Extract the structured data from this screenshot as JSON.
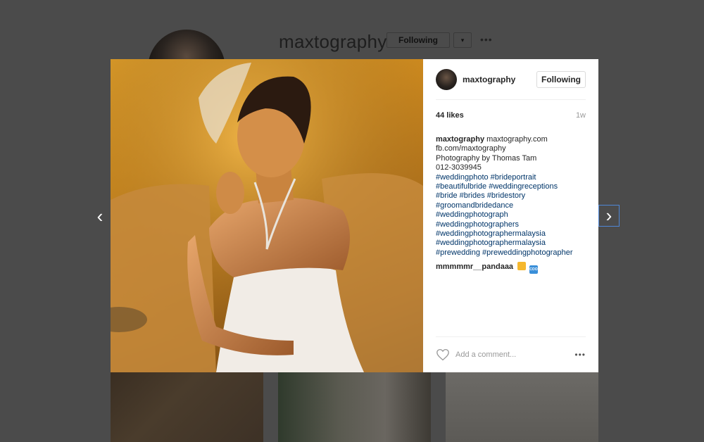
{
  "profile": {
    "username": "maxtography",
    "follow_label": "Following",
    "caret_icon": "▾",
    "more_icon": "•••"
  },
  "post": {
    "author": "maxtography",
    "follow_label": "Following",
    "likes": "44 likes",
    "time": "1w",
    "caption_first": "maxtography.com",
    "caption_lines": [
      "fb.com/maxtography",
      "Photography by Thomas Tam",
      "012-3039945"
    ],
    "hashtags": [
      "#weddingphoto #brideportrait",
      "#beautifulbride #weddingreceptions",
      "#bride #brides #bridestory",
      "#groomandbridedance",
      "#weddingphotograph",
      "#weddingphotographers",
      "#weddingphotographermalaysia",
      "#weddingphotographermalaysia",
      "#prewedding #preweddingphotographer"
    ],
    "comment": {
      "author": "mmmmmr__pandaaa",
      "emoji_cool_text": "COOL"
    },
    "add_comment_placeholder": "Add a comment...",
    "more_icon": "•••"
  },
  "nav": {
    "prev_icon": "‹",
    "next_icon": "›"
  },
  "colors": {
    "overlay": "#4b4b4b",
    "hashtag": "#003569",
    "focus_border": "#4f87d6"
  }
}
